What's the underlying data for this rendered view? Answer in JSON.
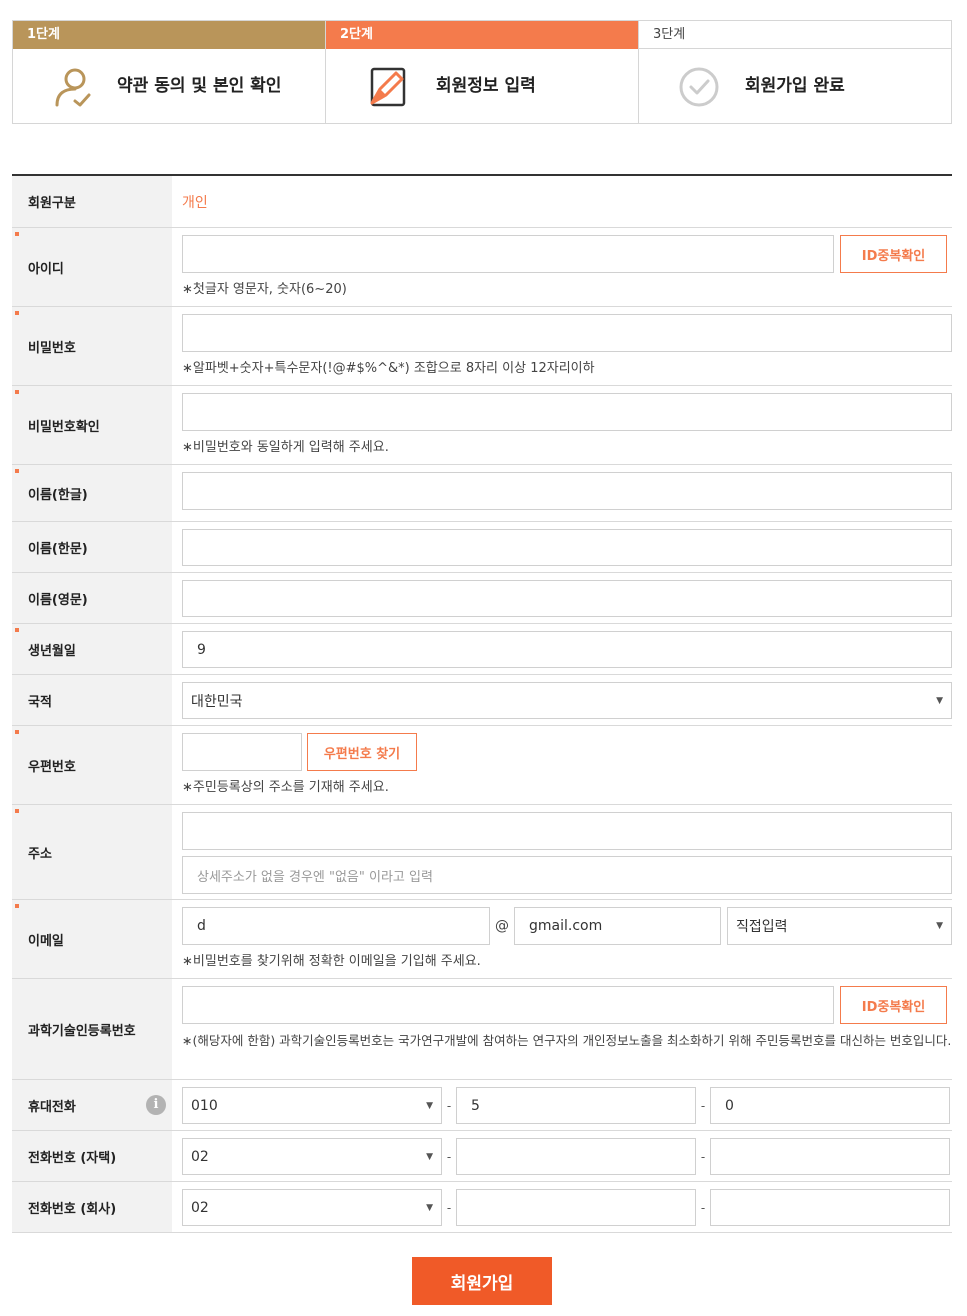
{
  "steps": [
    {
      "head": "1단계",
      "label": "약관 동의 및 본인 확인",
      "icon": "user-icon"
    },
    {
      "head": "2단계",
      "label": "회원정보 입력",
      "icon": "pencil-icon"
    },
    {
      "head": "3단계",
      "label": "회원가입 완료",
      "icon": "check-circle-icon"
    }
  ],
  "colors": {
    "step1": "#b9955a",
    "step2": "#f47b4c",
    "accent": "#f47b4c",
    "submit": "#f05a28"
  },
  "form": {
    "member_type": {
      "label": "회원구분",
      "value": "개인"
    },
    "user_id": {
      "label": "아이디",
      "value": "",
      "check_button": "ID중복확인",
      "hint": "∗첫글자 영문자, 숫자(6~20)"
    },
    "password": {
      "label": "비밀번호",
      "value": "",
      "hint": "∗알파벳+숫자+특수문자(!@#$%^&*) 조합으로 8자리 이상 12자리이하"
    },
    "password_confirm": {
      "label": "비밀번호확인",
      "value": "",
      "hint": "∗비밀번호와 동일하게 입력해 주세요."
    },
    "name_kr": {
      "label": "이름(한글)",
      "value": ""
    },
    "name_hanja": {
      "label": "이름(한문)",
      "value": ""
    },
    "name_en": {
      "label": "이름(영문)",
      "value": ""
    },
    "birth": {
      "label": "생년월일",
      "value": "9"
    },
    "nationality": {
      "label": "국적",
      "value": "대한민국"
    },
    "zipcode": {
      "label": "우편번호",
      "value": "",
      "search_button": "우편번호 찾기",
      "hint": "∗주민등록상의 주소를 기재해 주세요."
    },
    "address": {
      "label": "주소",
      "value": "",
      "detail_placeholder": "상세주소가 없을 경우엔 \"없음\" 이라고 입력"
    },
    "email": {
      "label": "이메일",
      "local": "d",
      "at": "@",
      "domain": "gmail.com",
      "domain_select": "직접입력",
      "hint": "∗비밀번호를 찾기위해 정확한 이메일을 기입해 주세요."
    },
    "researcher_no": {
      "label": "과학기술인등록번호",
      "value": "",
      "check_button": "ID중복확인",
      "hint": "∗(해당자에 한함) 과학기술인등록번호는 국가연구개발에 참여하는 연구자의 개인정보노출을 최소화하기 위해 주민등록번호를 대신하는 번호입니다."
    },
    "mobile": {
      "label": "휴대전화",
      "prefix": "010",
      "middle": "5",
      "last": "0",
      "info_icon": "i"
    },
    "home_phone": {
      "label": "전화번호 (자택)",
      "prefix": "02",
      "middle": "",
      "last": ""
    },
    "work_phone": {
      "label": "전화번호 (회사)",
      "prefix": "02",
      "middle": "",
      "last": ""
    },
    "dash": "-"
  },
  "submit_label": "회원가입"
}
